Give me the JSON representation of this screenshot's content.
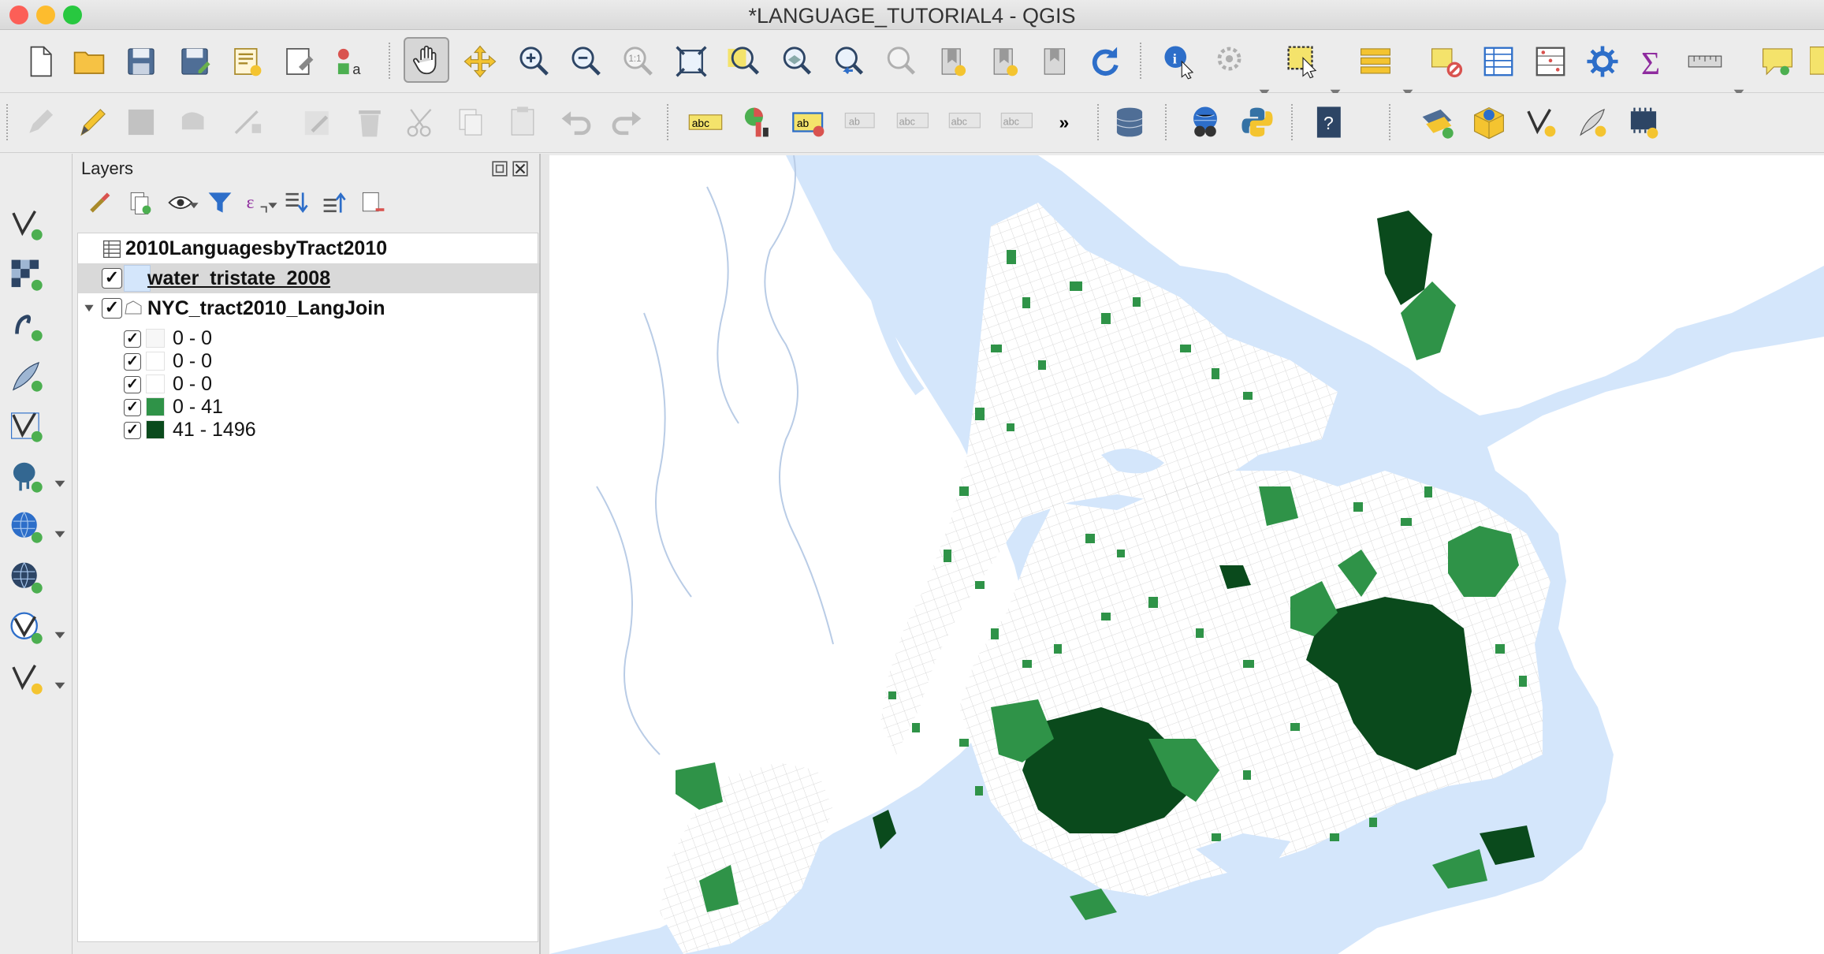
{
  "window": {
    "title": "*LANGUAGE_TUTORIAL4 - QGIS",
    "traffic_colors": [
      "#fc5f57",
      "#fdbc2e",
      "#28c840"
    ]
  },
  "layers_panel": {
    "title": "Layers",
    "layers": [
      {
        "name": "2010LanguagesbyTract2010",
        "kind": "table",
        "checked": false
      },
      {
        "name": "water_tristate_2008",
        "kind": "polygon",
        "checked": true,
        "fill": "#d4e6fb",
        "selected": true
      },
      {
        "name": "NYC_tract2010_LangJoin",
        "kind": "polygon",
        "checked": true,
        "expanded": true,
        "classes": [
          {
            "label": "0 - 0",
            "color": "#f7f7f7",
            "checked": true
          },
          {
            "label": "0 - 0",
            "color": "#ffffff",
            "checked": true
          },
          {
            "label": "0 - 0",
            "color": "#ffffff",
            "checked": true
          },
          {
            "label": "0 - 41",
            "color": "#2f9348",
            "checked": true
          },
          {
            "label": "41 - 1496",
            "color": "#0a4a1c",
            "checked": true
          }
        ]
      }
    ]
  },
  "colors": {
    "water": "#d4e6fb",
    "land": "#ffffff",
    "tract_low": "#2f9348",
    "tract_high": "#0a4a1c"
  },
  "icons": {
    "main_toolbar": [
      "new-project-icon",
      "open-project-icon",
      "save-project-icon",
      "save-as-icon",
      "new-print-layout-icon",
      "layout-manager-icon",
      "style-manager-icon",
      "pan-map-icon",
      "pan-to-selection-icon",
      "zoom-in-icon",
      "zoom-out-icon",
      "zoom-native-icon",
      "zoom-full-icon",
      "zoom-to-selection-icon",
      "zoom-to-layer-icon",
      "zoom-last-icon",
      "zoom-next-icon",
      "new-bookmark-icon",
      "show-bookmarks-icon",
      "temporal-controller-icon",
      "refresh-icon",
      "identify-icon",
      "run-action-icon",
      "select-features-icon",
      "open-attribute-table-icon",
      "deselect-icon",
      "attribute-table-icon",
      "field-calculator-icon",
      "toolbox-icon",
      "statistics-icon",
      "measure-icon",
      "map-tips-icon"
    ],
    "digitize_toolbar": [
      "current-edits-icon",
      "toggle-editing-icon",
      "save-edits-icon",
      "add-feature-icon",
      "vertex-tool-icon",
      "modify-attributes-icon",
      "delete-selected-icon",
      "cut-features-icon",
      "copy-features-icon",
      "paste-features-icon",
      "undo-icon",
      "redo-icon",
      "label-toolbar-icon",
      "diagram-options-icon",
      "highlight-pinned-labels-icon",
      "pin-labels-icon",
      "show-hide-labels-icon",
      "move-label-icon",
      "rotate-label-icon",
      "more-tools-icon",
      "db-manager-icon",
      "metasearch-icon",
      "python-console-icon",
      "help-icon",
      "add-wms-icon",
      "add-3d-layer-icon",
      "new-vector-layer-icon",
      "new-shapefile-icon",
      "new-virtual-layer-icon"
    ],
    "left_toolbar": [
      "add-vector-layer-icon",
      "add-raster-layer-icon",
      "add-delimited-text-icon",
      "add-spatialite-icon",
      "add-virtual-layer-icon",
      "add-postgis-icon",
      "add-wms-wmts-icon",
      "add-wfs-icon",
      "add-xyz-icon",
      "new-scratch-layer-icon"
    ]
  }
}
